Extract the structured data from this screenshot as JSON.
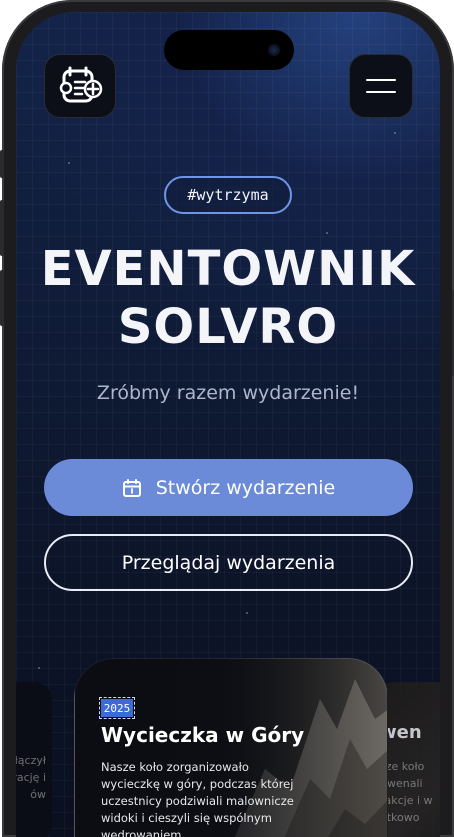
{
  "header": {
    "logo_icon": "schedule-plus-icon",
    "menu_icon": "hamburger-menu-icon"
  },
  "hero": {
    "tag": "#wytrzyma",
    "title_line1": "EVENTOWNIK",
    "title_line2": "SOLVRO",
    "subtitle": "Zróbmy razem wydarzenie!"
  },
  "actions": {
    "create_label": "Stwórz wydarzenie",
    "create_icon": "calendar-icon",
    "browse_label": "Przeglądaj wydarzenia"
  },
  "carousel": {
    "main": {
      "year": "2025",
      "title": "Wycieczka w Góry",
      "description": "Nasze koło zorganizowało wycieczkę w góry, podczas której uczestnicy podziwiali malownicze widoki i cieszyli się wspólnym wędrowaniem."
    },
    "left_peek": {
      "lines": [
        "łączył",
        "grację i",
        "ów"
      ]
    },
    "right_peek": {
      "heading": "wen",
      "lines": [
        "sze koło",
        "uwenali",
        "rakcje i w",
        "ątkowo"
      ]
    }
  },
  "colors": {
    "accent": "#6b8ad8",
    "tag_border": "#6f95e6",
    "badge": "#3c6bd6",
    "background": "#0f1b36"
  }
}
